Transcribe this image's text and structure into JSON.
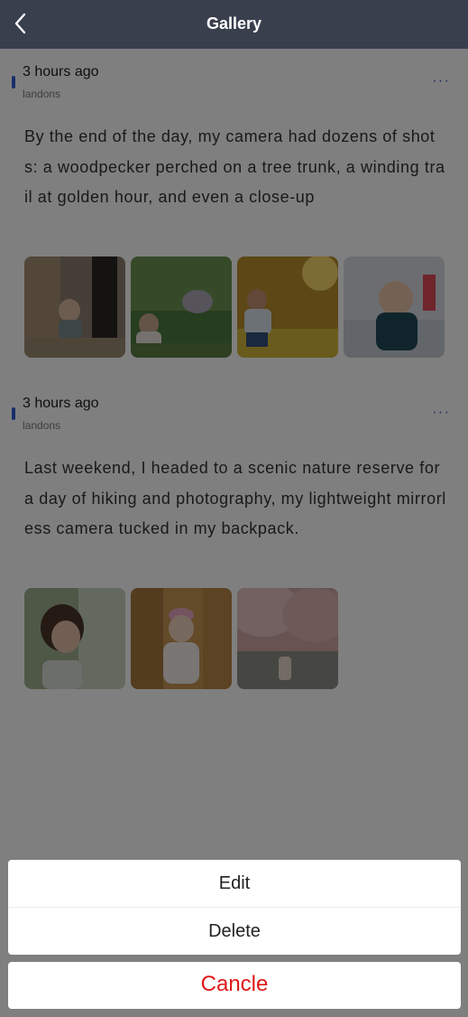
{
  "navbar": {
    "title": "Gallery"
  },
  "posts": [
    {
      "time": "3 hours ago",
      "user": "landons",
      "more": "···",
      "text": "By the end of the day, my camera had dozens of shots: a woodpecker perched on a tree trunk, a winding trail at golden hour, and even a close-up"
    },
    {
      "time": "3 hours ago",
      "user": "landons",
      "more": "···",
      "text": "Last weekend, I headed to a scenic nature reserve for a day of hiking and photography, my lightweight mirrorless camera tucked in my backpack."
    }
  ],
  "action_sheet": {
    "edit": "Edit",
    "delete": "Delete",
    "cancel": "Cancle"
  },
  "colors": {
    "navbar": "#3a3f4e",
    "accent": "#2f5dd6",
    "cancel_text": "#e01818"
  }
}
